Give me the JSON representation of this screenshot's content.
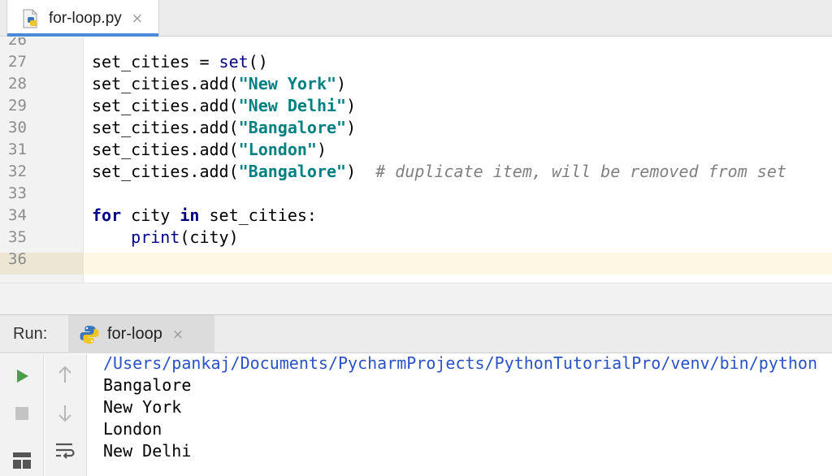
{
  "editor_tab": {
    "label": "for-loop.py",
    "close": "×",
    "icon": "python-file-icon"
  },
  "editor": {
    "lines": [
      {
        "num": "26",
        "parts": []
      },
      {
        "num": "27",
        "parts": [
          {
            "t": "set_cities = ",
            "c": "plain"
          },
          {
            "t": "set",
            "c": "bi"
          },
          {
            "t": "()",
            "c": "plain"
          }
        ]
      },
      {
        "num": "28",
        "parts": [
          {
            "t": "set_cities.add(",
            "c": "plain"
          },
          {
            "t": "\"New York\"",
            "c": "str"
          },
          {
            "t": ")",
            "c": "plain"
          }
        ]
      },
      {
        "num": "29",
        "parts": [
          {
            "t": "set_cities.add(",
            "c": "plain"
          },
          {
            "t": "\"New Delhi\"",
            "c": "str"
          },
          {
            "t": ")",
            "c": "plain"
          }
        ]
      },
      {
        "num": "30",
        "parts": [
          {
            "t": "set_cities.add(",
            "c": "plain"
          },
          {
            "t": "\"Bangalore\"",
            "c": "str"
          },
          {
            "t": ")",
            "c": "plain"
          }
        ]
      },
      {
        "num": "31",
        "parts": [
          {
            "t": "set_cities.add(",
            "c": "plain"
          },
          {
            "t": "\"London\"",
            "c": "str"
          },
          {
            "t": ")",
            "c": "plain"
          }
        ]
      },
      {
        "num": "32",
        "parts": [
          {
            "t": "set_cities.add(",
            "c": "plain"
          },
          {
            "t": "\"Bangalore\"",
            "c": "str"
          },
          {
            "t": ")  ",
            "c": "plain"
          },
          {
            "t": "# duplicate item, will be removed from set",
            "c": "cm"
          }
        ]
      },
      {
        "num": "33",
        "parts": []
      },
      {
        "num": "34",
        "parts": [
          {
            "t": "for",
            "c": "kw"
          },
          {
            "t": " city ",
            "c": "plain"
          },
          {
            "t": "in",
            "c": "kw"
          },
          {
            "t": " set_cities:",
            "c": "plain"
          }
        ]
      },
      {
        "num": "35",
        "parts": [
          {
            "t": "    ",
            "c": "plain"
          },
          {
            "t": "print",
            "c": "bi"
          },
          {
            "t": "(city)",
            "c": "plain"
          }
        ]
      },
      {
        "num": "36",
        "parts": []
      }
    ]
  },
  "run_window": {
    "title": "Run:",
    "tab_label": "for-loop",
    "tab_close": "×",
    "tab_icon": "python-icon",
    "toolbar_icons": [
      "run-icon",
      "stop-icon",
      "layout-icon",
      "arrow-up-icon",
      "arrow-down-icon",
      "soft-wrap-icon"
    ],
    "output": [
      "/Users/pankaj/Documents/PycharmProjects/PythonTutorialPro/venv/bin/python",
      "Bangalore",
      "New York",
      "London",
      "New Delhi"
    ]
  },
  "colors": {
    "keyword": "#000080",
    "string": "#008080",
    "comment": "#808080",
    "link": "#2a52c6",
    "run_green": "#4a9e4a",
    "tab_accent": "#4b8ad8"
  }
}
